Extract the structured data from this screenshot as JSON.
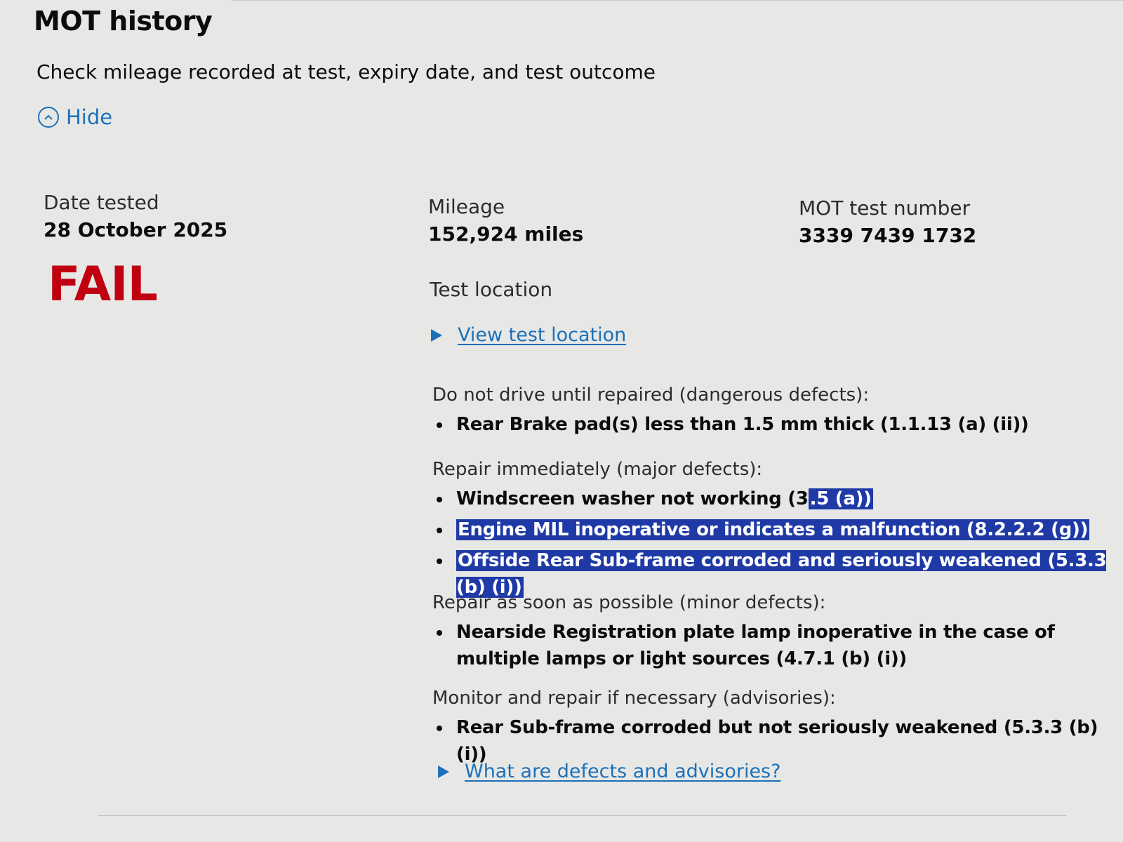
{
  "section": {
    "title": "MOT history",
    "lede": "Check mileage recorded at test, expiry date, and test outcome",
    "hide_label": "Hide"
  },
  "test": {
    "date_label": "Date tested",
    "date_value": "28 October 2025",
    "result": "FAIL",
    "mileage_label": "Mileage",
    "mileage_value": "152,924 miles",
    "number_label": "MOT test number",
    "number_value": "3339 7439 1732",
    "location_label": "Test location",
    "location_link": "View test location"
  },
  "defects": {
    "dangerous": {
      "heading": "Do not drive until repaired (dangerous defects):",
      "items": [
        "Rear Brake pad(s) less than 1.5 mm thick (1.1.13 (a) (ii))"
      ]
    },
    "major": {
      "heading": "Repair immediately (major defects):",
      "item1_prefix": "Windscreen washer not working (3",
      "item1_selected": ".5 (a))",
      "item2": "Engine MIL inoperative or indicates a malfunction (8.2.2.2 (g))",
      "item3": "Offside Rear Sub-frame corroded and seriously weakened (5.3.3 (b) (i))"
    },
    "minor": {
      "heading": "Repair as soon as possible (minor defects):",
      "items": [
        "Nearside Registration plate lamp inoperative in the case of multiple lamps or light sources (4.7.1 (b) (i))"
      ]
    },
    "advisory": {
      "heading": "Monitor and repair if necessary (advisories):",
      "items": [
        "Rear Sub-frame corroded but not seriously weakened (5.3.3 (b) (i))"
      ]
    }
  },
  "help_link": "What are defects and advisories?",
  "colors": {
    "link": "#1d70b8",
    "fail": "#c00010",
    "selection": "#1f3aa6",
    "background": "#e7e8e6"
  },
  "icons": [
    "chevron-up-circle-icon",
    "triangle-right-icon"
  ]
}
